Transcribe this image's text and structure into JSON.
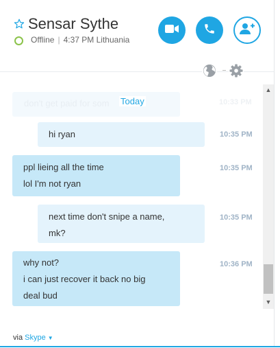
{
  "contact": {
    "name": "Sensar Sythe",
    "presence": "Offline",
    "local_time": "4:37 PM Lithuania",
    "presence_color": "#8bc34a"
  },
  "header_actions": [
    {
      "icon": "video-call-icon",
      "style": "filled"
    },
    {
      "icon": "phone-call-icon",
      "style": "filled"
    },
    {
      "icon": "add-contact-icon",
      "style": "outline"
    }
  ],
  "toolbar": {
    "icons": [
      "globe-icon",
      "gear-icon"
    ]
  },
  "conversation": {
    "date_separator": "Today",
    "faded_message": {
      "text": "don't get paid for som",
      "time": "10:33 PM"
    },
    "messages": [
      {
        "direction": "outgoing",
        "lines": [
          "hi ryan"
        ],
        "time": "10:35 PM"
      },
      {
        "direction": "incoming",
        "lines": [
          "ppl lieing all the time",
          "lol I'm not ryan"
        ],
        "time": "10:35 PM"
      },
      {
        "direction": "outgoing",
        "lines": [
          "next time don't snipe a name,",
          "mk?"
        ],
        "time": "10:35 PM"
      },
      {
        "direction": "incoming",
        "lines": [
          "why not?",
          "i can just recover it back no big",
          "deal bud"
        ],
        "time": "10:36 PM"
      }
    ]
  },
  "footer": {
    "via_label": "via",
    "service_name": "Skype"
  },
  "colors": {
    "accent": "#1fa6e3",
    "outgoing_bubble": "#e4f3fc",
    "incoming_bubble": "#c6e8f8",
    "timestamp": "#9fb3c6"
  }
}
